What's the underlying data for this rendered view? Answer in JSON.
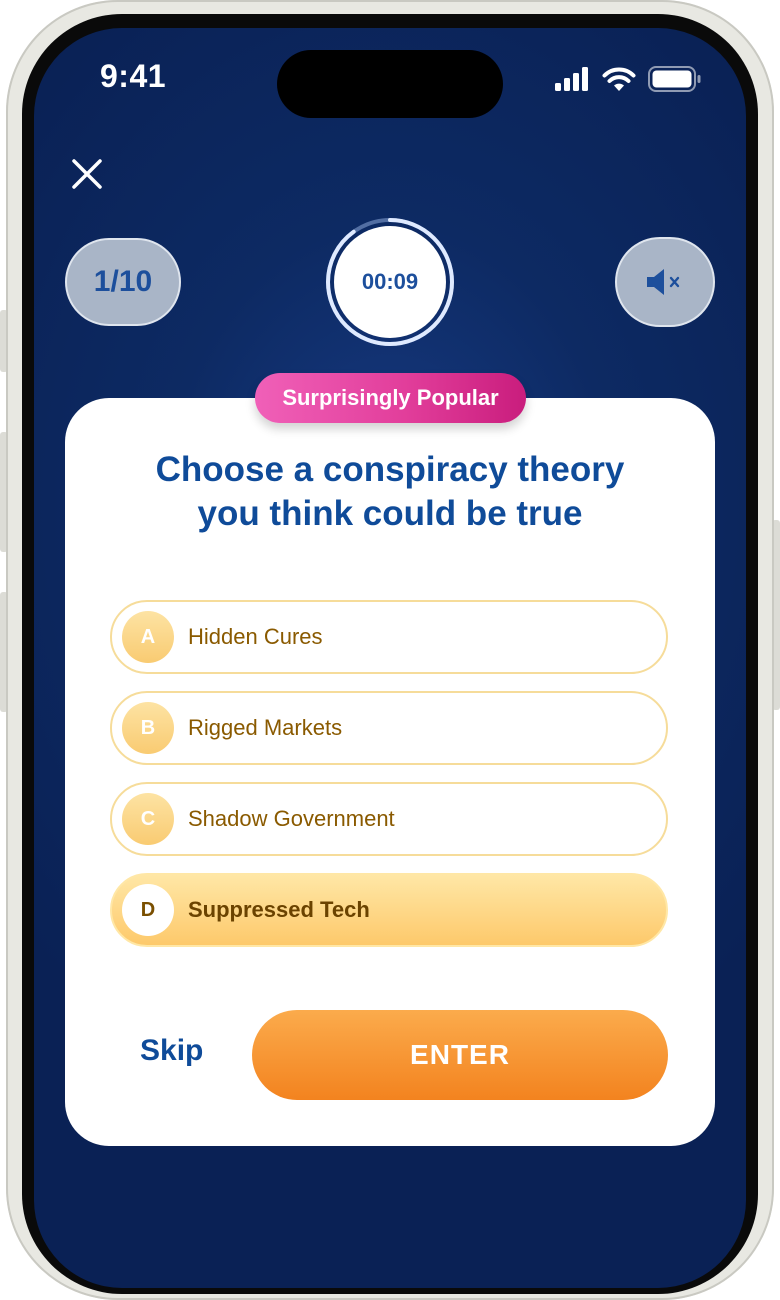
{
  "status_bar": {
    "time": "9:41",
    "icons": [
      "signal-icon",
      "wifi-icon",
      "battery-icon"
    ]
  },
  "header": {
    "close_icon": "close-icon",
    "progress": "1/10",
    "timer": "00:09",
    "timer_progress": 0.9,
    "mute_icon": "speaker-muted-icon"
  },
  "card": {
    "category_badge": "Surprisingly Popular",
    "question_line1": "Choose a conspiracy theory",
    "question_line2": "you think could be true",
    "options": [
      {
        "letter": "A",
        "label": "Hidden Cures",
        "selected": false
      },
      {
        "letter": "B",
        "label": "Rigged Markets",
        "selected": false
      },
      {
        "letter": "C",
        "label": "Shadow Government",
        "selected": false
      },
      {
        "letter": "D",
        "label": "Suppressed Tech",
        "selected": true
      }
    ],
    "skip_label": "Skip",
    "enter_label": "ENTER"
  },
  "colors": {
    "background": "#0d2a63",
    "primary_text": "#0f4b99",
    "badge": "#e23e9b",
    "option_border": "#f6dc9a",
    "selected_option": "#fdc96b",
    "enter_button": "#f3831f"
  }
}
